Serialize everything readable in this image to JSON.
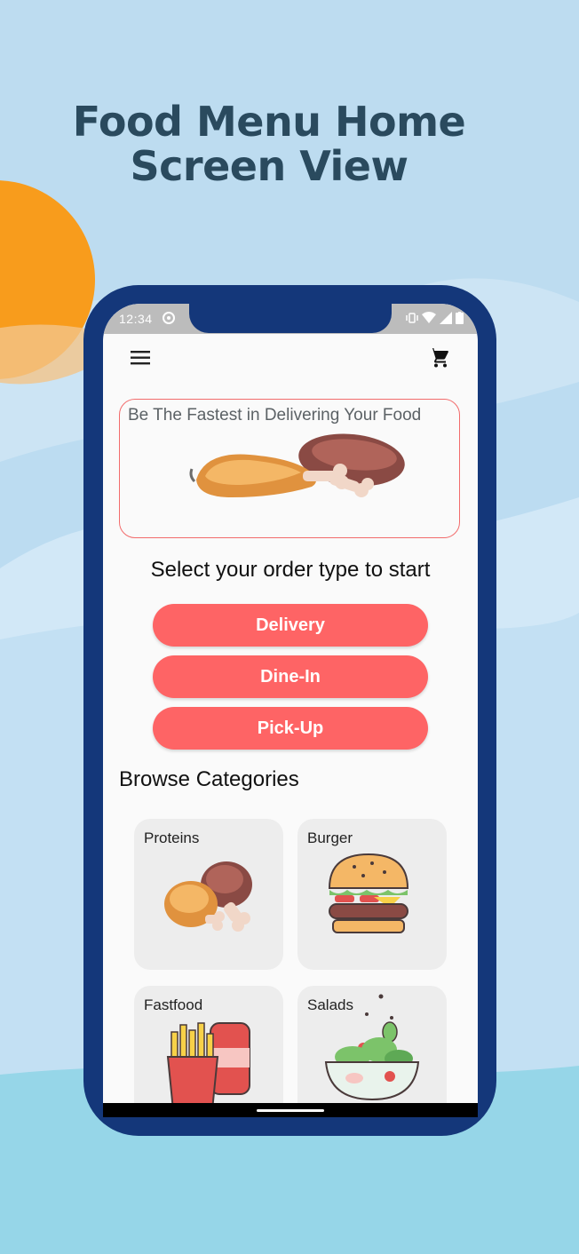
{
  "headline": {
    "line1": "Food Menu Home",
    "line2": "Screen View"
  },
  "status_bar": {
    "time": "12:34",
    "icons": [
      "do-not-disturb-icon",
      "vibrate-icon",
      "wifi-icon",
      "signal-icon",
      "battery-icon"
    ]
  },
  "app_bar": {
    "left_icon": "hamburger-menu-icon",
    "right_icon": "shopping-cart-icon"
  },
  "banner": {
    "text": "Be The Fastest in Delivering Your Food",
    "image": "chicken-drumsticks-illustration"
  },
  "order": {
    "prompt": "Select your order type to start",
    "buttons": [
      {
        "label": "Delivery"
      },
      {
        "label": "Dine-In"
      },
      {
        "label": "Pick-Up"
      }
    ]
  },
  "categories": {
    "title": "Browse Categories",
    "items": [
      {
        "label": "Proteins",
        "icon": "chicken-leg-icon"
      },
      {
        "label": "Burger",
        "icon": "burger-icon"
      },
      {
        "label": "Fastfood",
        "icon": "fries-and-soda-icon"
      },
      {
        "label": "Salads",
        "icon": "salad-bowl-icon"
      }
    ]
  },
  "colors": {
    "accent": "#fe6465",
    "phone_frame": "#14377a",
    "headline": "#2a4a5e",
    "background_sky": "#bddcf0",
    "sun": "#f89c1c"
  }
}
